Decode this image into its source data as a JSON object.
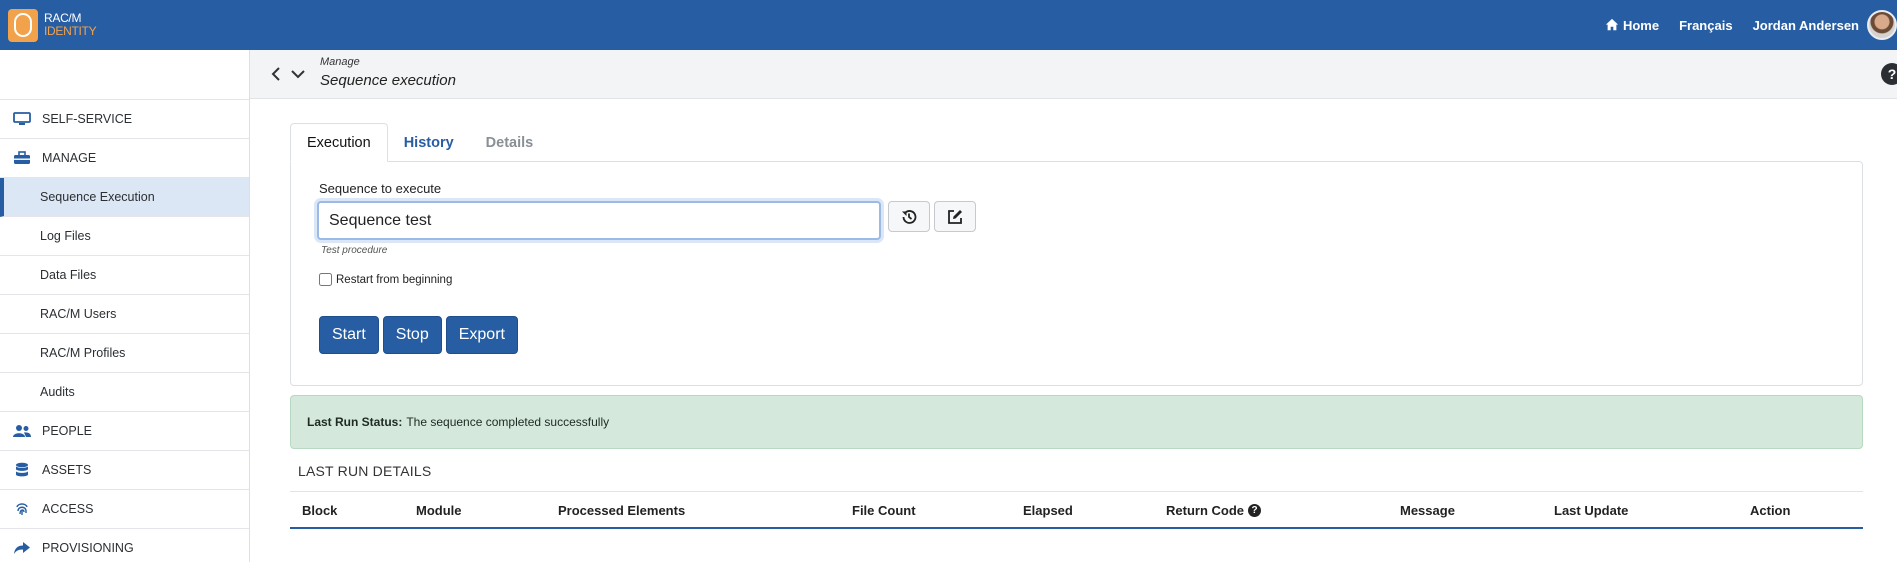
{
  "brand": {
    "line1": "RAC/M",
    "line2": "IDENTITY"
  },
  "topbar": {
    "home": "Home",
    "language": "Français",
    "user": "Jordan Andersen"
  },
  "sidebar": {
    "items": [
      {
        "label": "SELF-SERVICE",
        "icon": "monitor-icon",
        "level": "top"
      },
      {
        "label": "MANAGE",
        "icon": "toolbox-icon",
        "level": "top"
      },
      {
        "label": "Sequence Execution",
        "level": "sub",
        "active": true
      },
      {
        "label": "Log Files",
        "level": "sub"
      },
      {
        "label": "Data Files",
        "level": "sub"
      },
      {
        "label": "RAC/M Users",
        "level": "sub"
      },
      {
        "label": "RAC/M Profiles",
        "level": "sub"
      },
      {
        "label": "Audits",
        "level": "sub"
      },
      {
        "label": "PEOPLE",
        "icon": "people-icon",
        "level": "top"
      },
      {
        "label": "ASSETS",
        "icon": "database-icon",
        "level": "top"
      },
      {
        "label": "ACCESS",
        "icon": "fingerprint-icon",
        "level": "top"
      },
      {
        "label": "PROVISIONING",
        "icon": "share-icon",
        "level": "top"
      }
    ]
  },
  "header": {
    "breadcrumb_parent": "Manage",
    "title": "Sequence execution",
    "help": "?"
  },
  "tabs": [
    {
      "label": "Execution",
      "state": "active"
    },
    {
      "label": "History",
      "state": "link"
    },
    {
      "label": "Details",
      "state": "disabled"
    }
  ],
  "form": {
    "sequence_label": "Sequence to execute",
    "sequence_value": "Sequence test",
    "sequence_hint": "Test procedure",
    "restart_label": "Restart from beginning",
    "restart_checked": false,
    "buttons": {
      "start": "Start",
      "stop": "Stop",
      "export": "Export"
    }
  },
  "status": {
    "label": "Last Run Status:",
    "text": "The sequence completed successfully",
    "color": "#d4e8dc"
  },
  "details": {
    "title": "LAST RUN DETAILS",
    "columns": [
      "Block",
      "Module",
      "Processed Elements",
      "File Count",
      "Elapsed",
      "Return Code",
      "Message",
      "Last Update",
      "Action"
    ],
    "return_code_help": "?"
  },
  "colors": {
    "primary": "#275ea3",
    "accent": "#f2a24b"
  }
}
